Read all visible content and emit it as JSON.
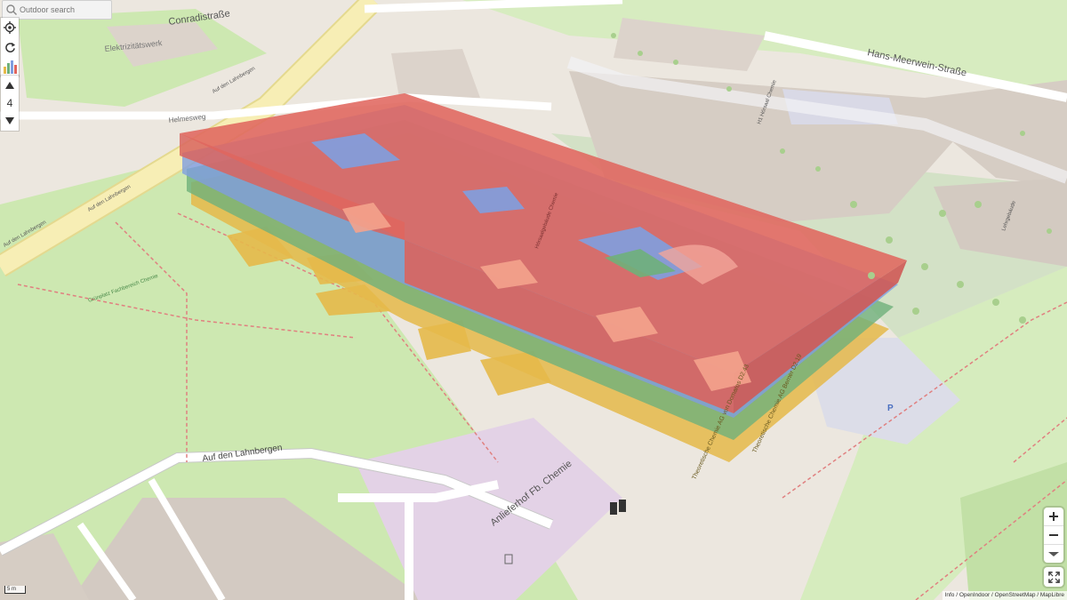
{
  "search": {
    "placeholder": "Outdoor search"
  },
  "level_selector": {
    "current_level": "4"
  },
  "streets": {
    "conradi": "Conradistraße",
    "meerwein": "Hans-Meerwein-Straße",
    "lahnberge_upper": "Auf den Lahnbergen",
    "lahnberge_lower": "Auf den Lahnbergen",
    "lahnberge_main": "Auf den Lahnbergen",
    "lahnberge_side": "Auf den Lahnbergen",
    "helmeweg": "Helmesweg"
  },
  "labels": {
    "elektro": "Elektrizitätswerk",
    "gruenplatz": "Grünplatz Fachbereich Chemie",
    "delivery": "Anlieferhof Fb. Chemie",
    "hs_building": "H1 Hörsaal Chemie",
    "chem_center": "Hörsaalgebäude Chemie",
    "lebensw": "Lehrgebäude",
    "room_a": "Theoretische Chemie AG Berner D2.19",
    "room_b": "Theoretische Chemie AG von Domaros D2.43"
  },
  "attribution": "Info / OpenIndoor / OpenStreetMap / MapLibre",
  "scale_label": "5 m",
  "colors": {
    "level_top": "#e0665f",
    "level_blue": "#7f9ee0",
    "level_green": "#6fb07a",
    "level_yellow": "#e5b94a",
    "park": "#cde8b1",
    "road": "#fafaf0",
    "road_major": "#f5e9a8",
    "building": "#d9d0c9"
  }
}
